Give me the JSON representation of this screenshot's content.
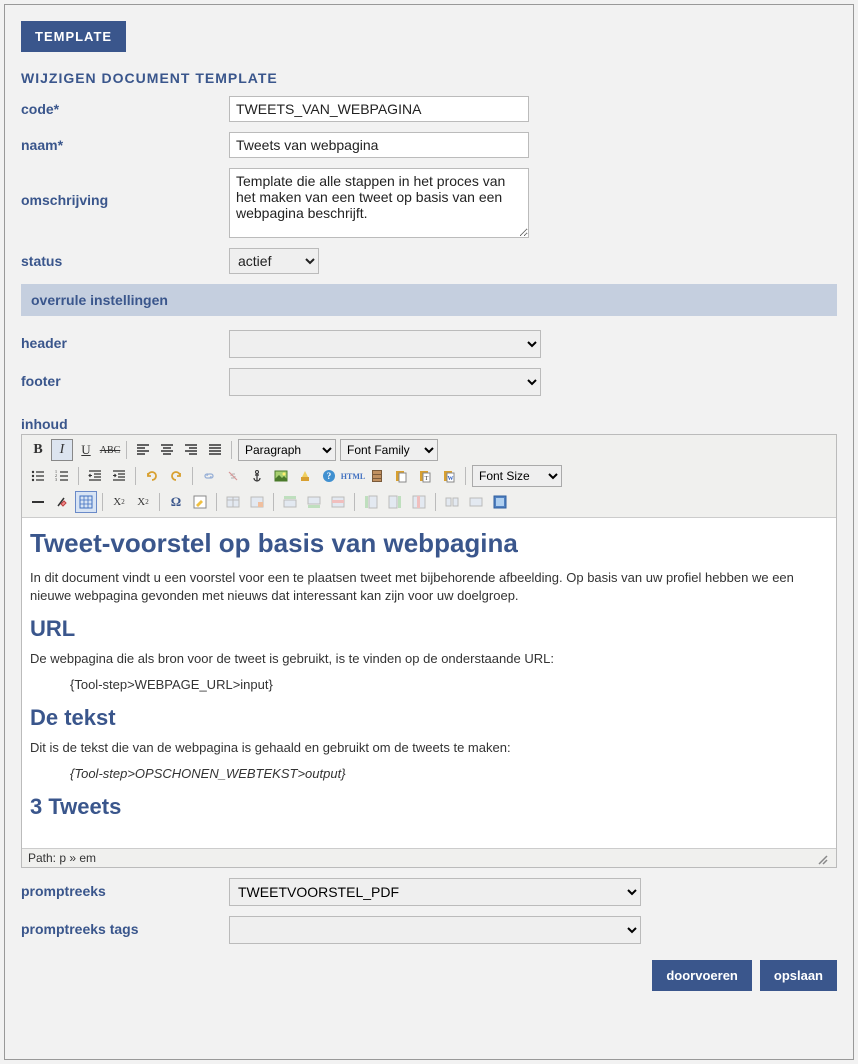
{
  "header": {
    "template_button": "TEMPLATE"
  },
  "section": {
    "title": "WIJZIGEN DOCUMENT TEMPLATE"
  },
  "labels": {
    "code": "code*",
    "naam": "naam*",
    "omschrijving": "omschrijving",
    "status": "status",
    "overrule": "overrule instellingen",
    "header": "header",
    "footer": "footer",
    "inhoud": "inhoud",
    "promptreeks": "promptreeks",
    "promptreeks_tags": "promptreeks tags"
  },
  "fields": {
    "code": "TWEETS_VAN_WEBPAGINA",
    "naam": "Tweets van webpagina",
    "omschrijving": "Template die alle stappen in het proces van het maken van een tweet op basis van een webpagina beschrijft.",
    "status": "actief",
    "header": "",
    "footer": "",
    "promptreeks": "TWEETVOORSTEL_PDF",
    "promptreeks_tags": ""
  },
  "toolbar": {
    "paragraph": "Paragraph",
    "font_family": "Font Family",
    "font_size": "Font Size"
  },
  "editor": {
    "h1": "Tweet-voorstel op basis van webpagina",
    "p1": "In dit document vindt u een voorstel voor een te plaatsen tweet met bijbehorende afbeelding. Op basis van uw profiel hebben we een nieuwe webpagina gevonden met nieuws dat interessant kan zijn voor uw doelgroep.",
    "h2a": "URL",
    "p2": "De webpagina die als bron voor de tweet is gebruikt, is te vinden op de onderstaande URL:",
    "p3": "{Tool-step>WEBPAGE_URL>input}",
    "h2b": "De tekst",
    "p4": "Dit is de tekst die van de webpagina is gehaald en gebruikt om de tweets te maken:",
    "p5": "{Tool-step>OPSCHONEN_WEBTEKST>output}",
    "h2c": "3 Tweets",
    "path": "Path: p » em"
  },
  "buttons": {
    "doorvoeren": "doorvoeren",
    "opslaan": "opslaan"
  }
}
